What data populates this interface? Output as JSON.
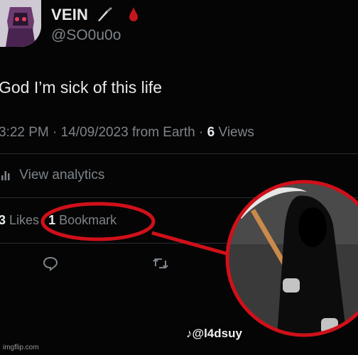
{
  "profile": {
    "name": "VEIN",
    "handle": "@SO0u0o",
    "avatar_icon": "avatar-image",
    "emojis": [
      "knife-icon",
      "blood-drop-icon"
    ]
  },
  "tweet": {
    "text": "God I’m sick of this life",
    "time": "3:22 PM",
    "date": "14/09/2023",
    "source": "from Earth",
    "views_count": "6",
    "views_label": "Views"
  },
  "analytics": {
    "label": "View analytics",
    "icon": "bar-chart-icon"
  },
  "engagement": {
    "likes_count": "3",
    "likes_label": "Likes",
    "bookmarks_count": "1",
    "bookmarks_label": "Bookmark"
  },
  "actions": [
    "reply-icon",
    "retweet-icon"
  ],
  "overlay": {
    "highlight_color": "#d0101a",
    "caption": "♪@l4dsuy"
  },
  "watermark": "imgflip.com"
}
